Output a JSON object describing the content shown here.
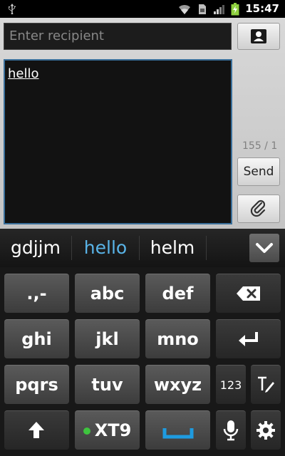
{
  "status_bar": {
    "time": "15:47",
    "icons": [
      "usb-icon",
      "wifi-icon",
      "sim-icon",
      "signal-icon",
      "battery-charging-icon"
    ]
  },
  "compose": {
    "recipient_placeholder": "Enter recipient",
    "message_text": "hello",
    "char_counter": "155 / 1",
    "send_label": "Send",
    "contact_icon": "contact-card-icon",
    "attach_icon": "paperclip-icon"
  },
  "suggestions": {
    "words": [
      "gdjjm",
      "hello",
      "helm"
    ],
    "selected": "hello",
    "collapse_icon": "chevron-down-icon"
  },
  "keyboard": {
    "row1": [
      ".,-",
      "abc",
      "def"
    ],
    "row2": [
      "ghi",
      "jkl",
      "mno"
    ],
    "row3": [
      "pqrs",
      "tuv",
      "wxyz",
      "123"
    ],
    "xt9_label": "XT9",
    "icons": {
      "backspace": "backspace-icon",
      "enter": "enter-icon",
      "text_mode": "text-mode-icon",
      "shift": "shift-arrow-icon",
      "space": "space-icon",
      "mic": "microphone-icon",
      "settings": "gear-icon"
    },
    "accent_color": "#1e9be0",
    "xt9_dot_color": "#3ec43e"
  }
}
